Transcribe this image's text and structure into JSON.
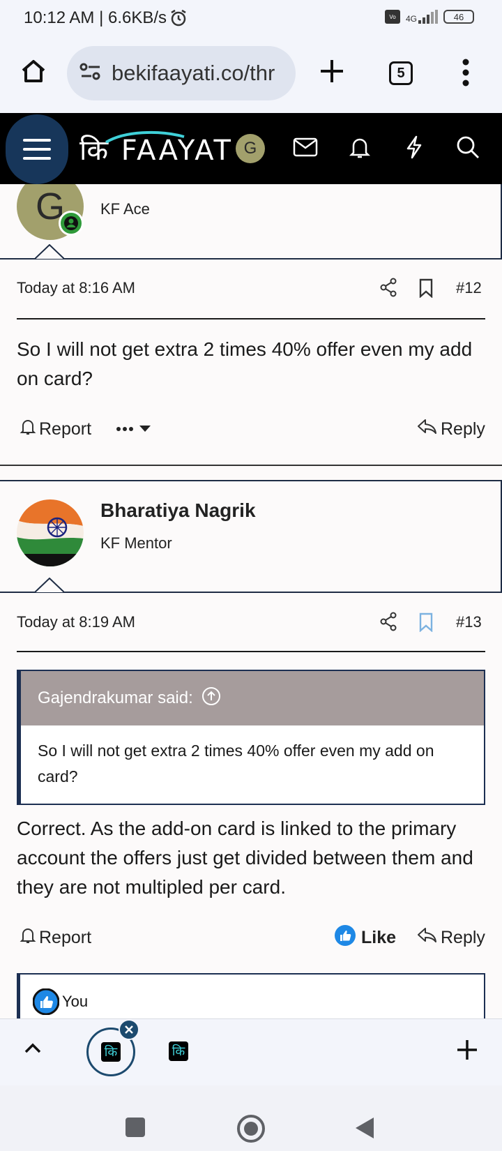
{
  "status_bar": {
    "time": "10:12 AM | 6.6KB/s",
    "network": "4G",
    "battery": "46"
  },
  "browser": {
    "url": "bekifaayati.co/thr",
    "tab_count": "5"
  },
  "site": {
    "logo_text": "कि FAAYAT",
    "user_initial": "G"
  },
  "posts": [
    {
      "avatar_initial": "G",
      "author": "Gajendrakumar",
      "user_title": "KF Ace",
      "timestamp": "Today at 8:16 AM",
      "post_number": "#12",
      "body": "So I will not get extra 2 times 40% offer even my add on card?",
      "report_label": "Report",
      "reply_label": "Reply"
    },
    {
      "author": "Bharatiya Nagrik",
      "user_title": "KF Mentor",
      "timestamp": "Today at 8:19 AM",
      "post_number": "#13",
      "quote": {
        "author_said": "Gajendrakumar said:",
        "text": "So I will not get extra 2 times 40% offer even my add on card?"
      },
      "body": "Correct. As the add-on card is linked to the primary account the offers just get divided between them and they are not multipled per card.",
      "report_label": "Report",
      "like_label": "Like",
      "reply_label": "Reply",
      "reactions_text": "You"
    }
  ],
  "tabs": {
    "thumb_glyph": "कि"
  },
  "colors": {
    "header_bg": "#000000",
    "menu_button": "#17365a",
    "quote_header": "#a69c9c",
    "like_blue": "#1e88e5",
    "accent_border": "#1c2f52"
  }
}
